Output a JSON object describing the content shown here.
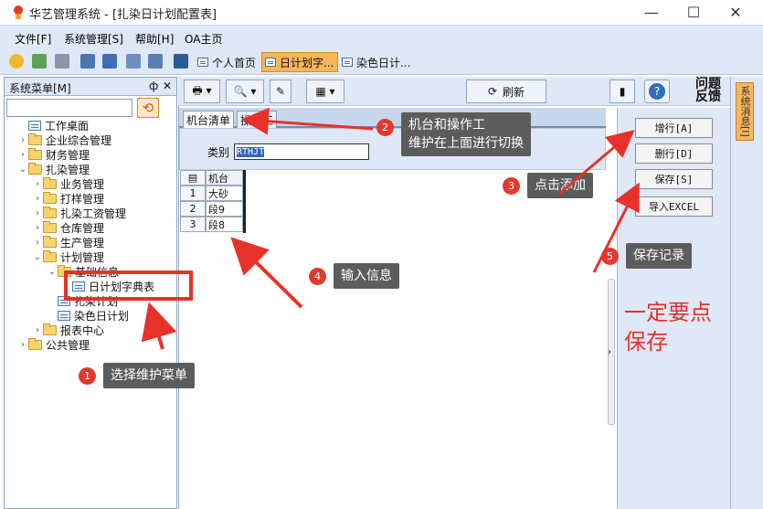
{
  "window": {
    "title": "华艺管理系统 - [扎染日计划配置表]",
    "minimize": "—",
    "maximize": "☐",
    "close": "✕"
  },
  "menu": [
    "文件[F]",
    "系统管理[S]",
    "帮助[H]",
    "OA主页"
  ],
  "toolbar": {
    "tab_home": "个人首页",
    "tab_daily_dict": "日计划字...",
    "tab_dye_daily": "染色日计..."
  },
  "sidebar": {
    "title": "系统菜单[M]",
    "pin": "ф",
    "close": "✕",
    "tree": [
      {
        "label": "工作桌面",
        "indent": 0,
        "type": "doc",
        "toggle": ""
      },
      {
        "label": "企业综合管理",
        "indent": 0,
        "type": "folder",
        "toggle": "›"
      },
      {
        "label": "财务管理",
        "indent": 0,
        "type": "folder",
        "toggle": "›"
      },
      {
        "label": "扎染管理",
        "indent": 0,
        "type": "folder",
        "toggle": "⌄"
      },
      {
        "label": "业务管理",
        "indent": 1,
        "type": "folder",
        "toggle": "›"
      },
      {
        "label": "打样管理",
        "indent": 1,
        "type": "folder",
        "toggle": "›"
      },
      {
        "label": "扎染工资管理",
        "indent": 1,
        "type": "folder",
        "toggle": "›"
      },
      {
        "label": "仓库管理",
        "indent": 1,
        "type": "folder",
        "toggle": "›"
      },
      {
        "label": "生产管理",
        "indent": 1,
        "type": "folder",
        "toggle": "›"
      },
      {
        "label": "计划管理",
        "indent": 1,
        "type": "folder",
        "toggle": "⌄"
      },
      {
        "label": "基础信息",
        "indent": 2,
        "type": "folder",
        "toggle": "⌄"
      },
      {
        "label": "日计划字典表",
        "indent": 3,
        "type": "doc",
        "toggle": ""
      },
      {
        "label": "扎染计划",
        "indent": 2,
        "type": "doc",
        "toggle": ""
      },
      {
        "label": "染色日计划",
        "indent": 2,
        "type": "doc",
        "toggle": ""
      },
      {
        "label": "报表中心",
        "indent": 1,
        "type": "folder",
        "toggle": "›"
      },
      {
        "label": "公共管理",
        "indent": 0,
        "type": "folder",
        "toggle": "›"
      }
    ]
  },
  "main_toolbar": {
    "refresh": "刷新",
    "feedback": "问题反馈"
  },
  "tabs": {
    "machine_list": "机台清单",
    "operator": "操作工"
  },
  "form": {
    "category_label": "类别",
    "category_value": "RTHJT"
  },
  "grid": {
    "header": "机台",
    "rows": [
      {
        "n": "1",
        "v": "大砂"
      },
      {
        "n": "2",
        "v": "段9"
      },
      {
        "n": "3",
        "v": "段8"
      }
    ]
  },
  "actions": {
    "add": "增行[A]",
    "delete": "删行[D]",
    "save": "保存[S]",
    "export": "导入EXCEL"
  },
  "side_tab": "系统消息[I]",
  "annotations": {
    "c1": {
      "num": "1",
      "text": "选择维护菜单"
    },
    "c2": {
      "num": "2",
      "line1": "机台和操作工",
      "line2": "维护在上面进行切换"
    },
    "c3": {
      "num": "3",
      "text": "点击添加"
    },
    "c4": {
      "num": "4",
      "text": "输入信息"
    },
    "c5": {
      "num": "5",
      "text": "保存记录"
    },
    "note_line1": "一定要点",
    "note_line2": "保存"
  },
  "colors": {
    "accent_orange": "#f7b55c",
    "panel_blue": "#dfe8f6",
    "annotation_red": "#e8312a",
    "callout_gray": "#5c5c5c"
  }
}
